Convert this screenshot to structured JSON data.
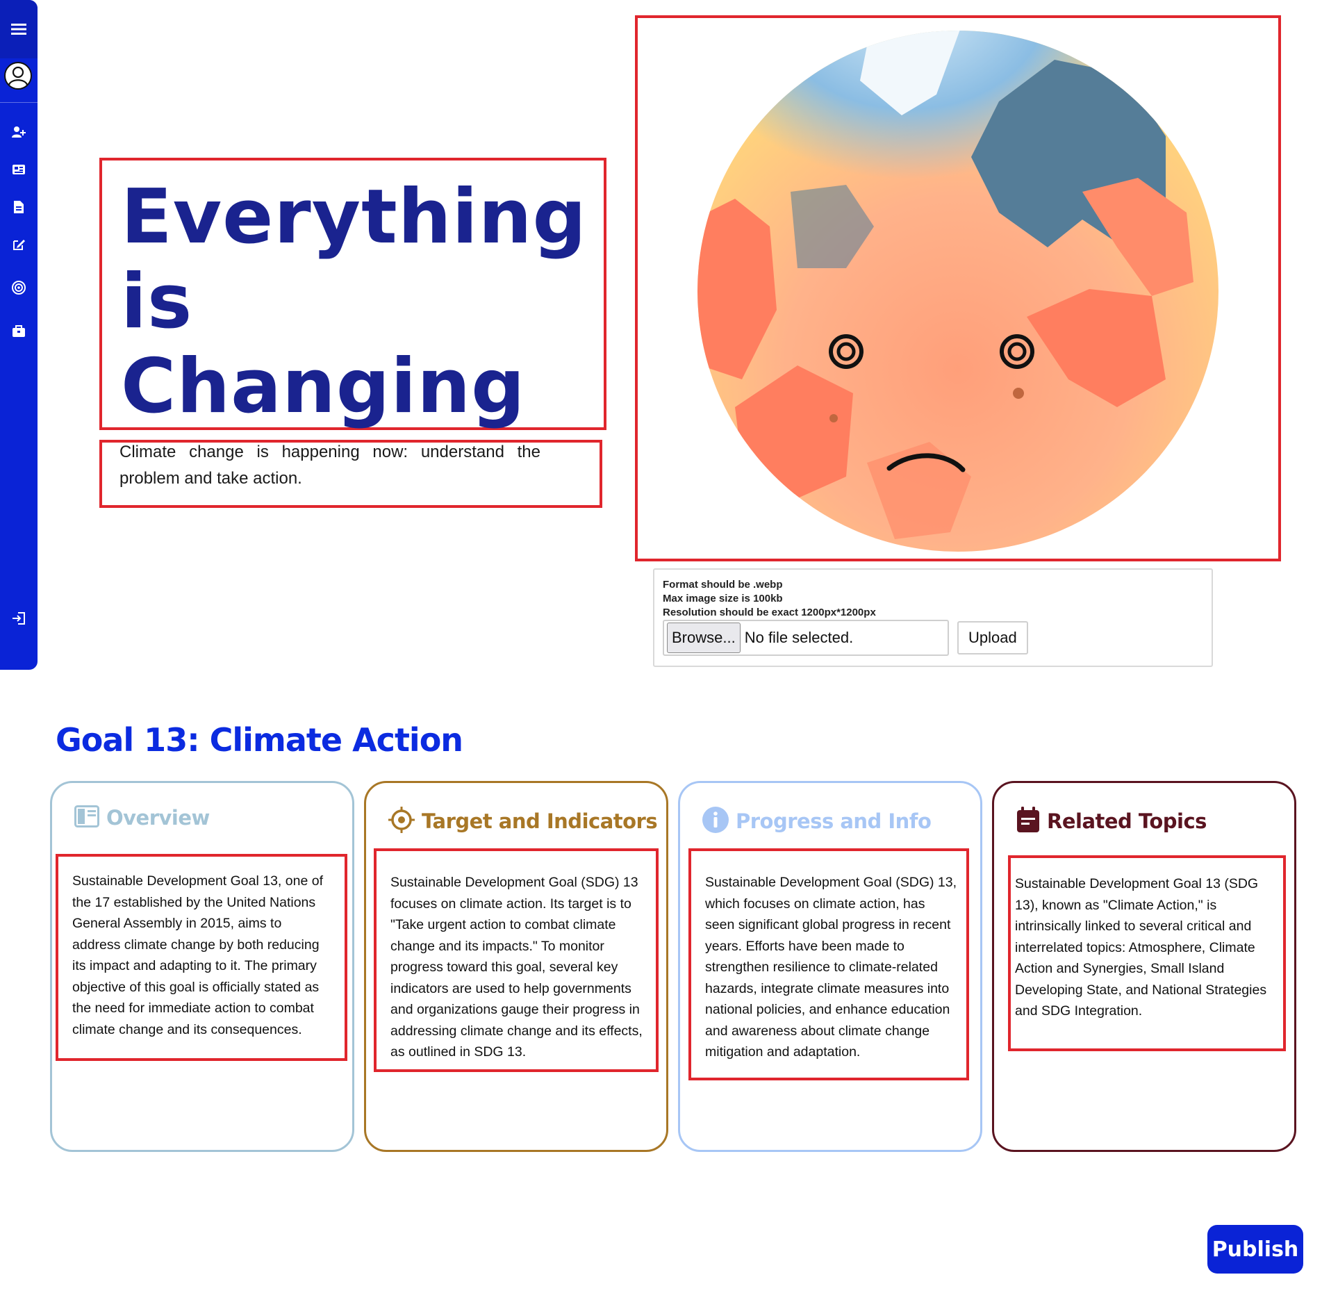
{
  "sidebar": {
    "items": [
      {
        "icon": "add-user-icon"
      },
      {
        "icon": "news-icon"
      },
      {
        "icon": "document-icon"
      },
      {
        "icon": "edit-icon"
      },
      {
        "icon": "target-icon"
      },
      {
        "icon": "briefcase-icon"
      }
    ],
    "logout_icon": "logout-icon",
    "accent": "#0a23d6"
  },
  "hero": {
    "title_line1": "Everything",
    "title_line2": "is",
    "title_line3": "Changing",
    "subtitle": "Climate change is happening now: understand the problem and take action.",
    "image_alt": "sad-earth-illustration"
  },
  "upload": {
    "note1": "Format should be .webp",
    "note2": "Max image size is 100kb",
    "note3": "Resolution should be exact 1200px*1200px",
    "browse_label": "Browse...",
    "file_status": "No file selected.",
    "upload_label": "Upload"
  },
  "goal": {
    "heading": "Goal 13: Climate Action",
    "cards": [
      {
        "title": "Overview",
        "color": "#a3c4d6",
        "icon": "overview-icon",
        "text": "Sustainable Development Goal 13, one of the 17 established by the United Nations General Assembly in 2015, aims to address climate change by both reducing its impact and adapting to it. The primary objective of this goal is officially stated as the need for immediate action to combat climate change and its consequences."
      },
      {
        "title": "Target and Indicators",
        "color": "#a87726",
        "icon": "target-icon",
        "text": "Sustainable Development Goal (SDG) 13 focuses on climate action. Its target is to \"Take urgent action to combat climate change and its impacts.\" To monitor progress toward this goal, several key indicators are used to help governments and organizations gauge their progress in addressing climate change and its effects, as outlined in SDG 13."
      },
      {
        "title": "Progress and Info",
        "color": "#a7c6f5",
        "icon": "info-icon",
        "text": "Sustainable Development Goal (SDG) 13, which focuses on climate action, has seen significant global progress in recent years. Efforts have been made to strengthen resilience to climate-related hazards, integrate climate measures into national policies, and enhance education and awareness about climate change mitigation and adaptation."
      },
      {
        "title": "Related Topics",
        "color": "#5a1420",
        "icon": "calendar-icon",
        "text": "Sustainable Development Goal 13 (SDG 13), known as \"Climate Action,\" is intrinsically linked to several critical and interrelated topics: Atmosphere, Climate Action and Synergies, Small Island Developing State, and National Strategies and SDG Integration."
      }
    ]
  },
  "publish_label": "Publish"
}
